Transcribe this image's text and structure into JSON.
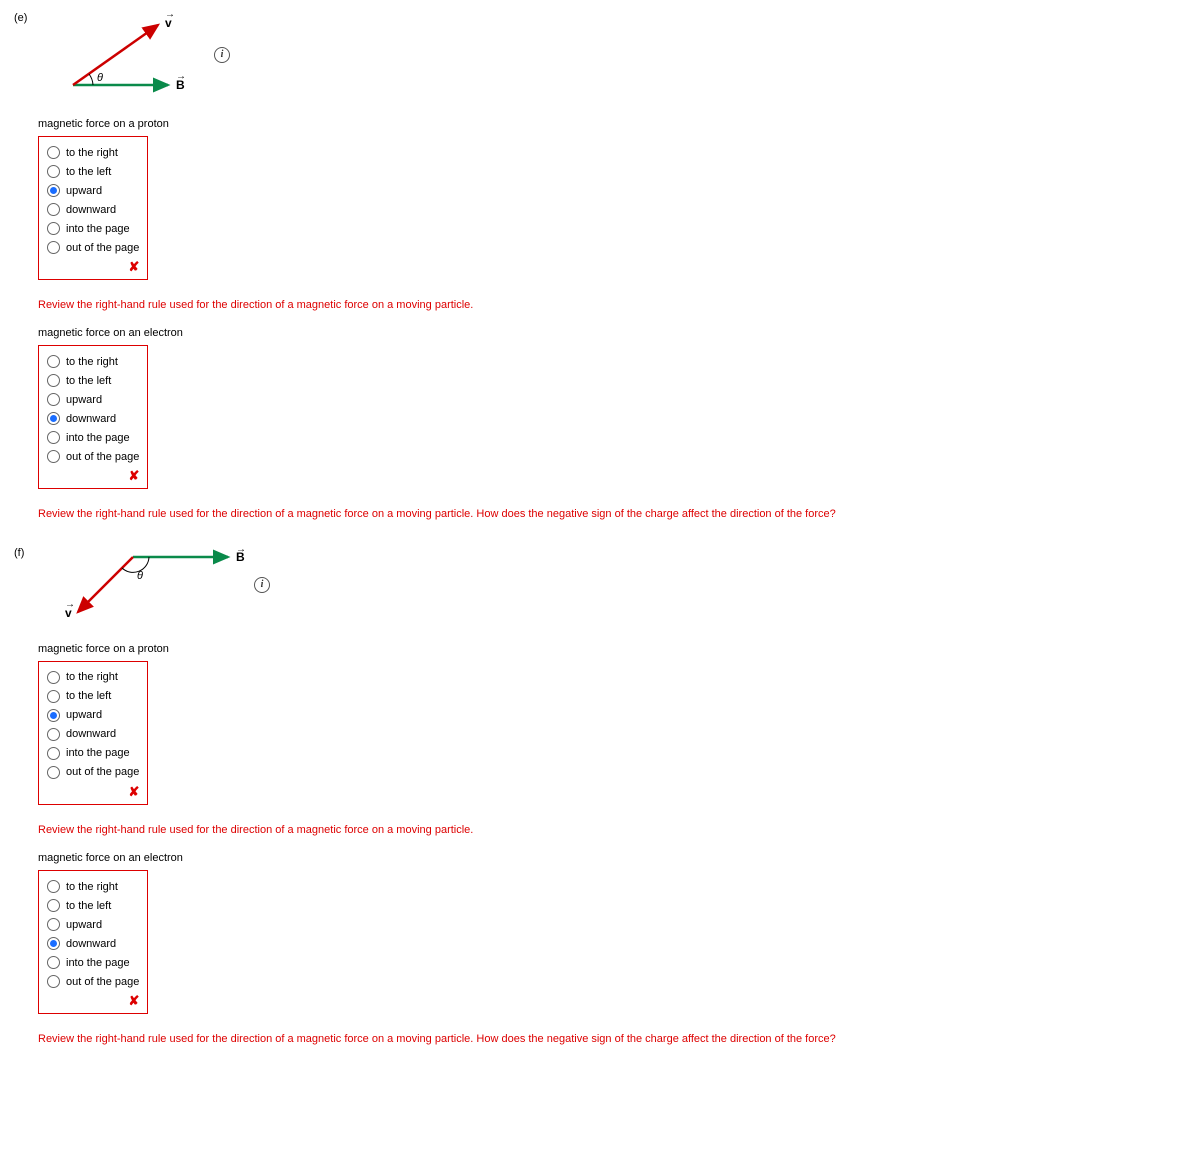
{
  "parts": [
    {
      "label": "(e)",
      "diagram": "e",
      "questions": [
        {
          "prompt": "magnetic force on a proton",
          "options": [
            "to the right",
            "to the left",
            "upward",
            "downward",
            "into the page",
            "out of the page"
          ],
          "selected": 2,
          "correct": false,
          "feedback": "Review the right-hand rule used for the direction of a magnetic force on a moving particle."
        },
        {
          "prompt": "magnetic force on an electron",
          "options": [
            "to the right",
            "to the left",
            "upward",
            "downward",
            "into the page",
            "out of the page"
          ],
          "selected": 3,
          "correct": false,
          "feedback": "Review the right-hand rule used for the direction of a magnetic force on a moving particle. How does the negative sign of the charge affect the direction of the force?"
        }
      ]
    },
    {
      "label": "(f)",
      "diagram": "f",
      "questions": [
        {
          "prompt": "magnetic force on a proton",
          "options": [
            "to the right",
            "to the left",
            "upward",
            "downward",
            "into the page",
            "out of the page"
          ],
          "selected": 2,
          "correct": false,
          "feedback": "Review the right-hand rule used for the direction of a magnetic force on a moving particle."
        },
        {
          "prompt": "magnetic force on an electron",
          "options": [
            "to the right",
            "to the left",
            "upward",
            "downward",
            "into the page",
            "out of the page"
          ],
          "selected": 3,
          "correct": false,
          "feedback": "Review the right-hand rule used for the direction of a magnetic force on a moving particle. How does the negative sign of the charge affect the direction of the force?"
        }
      ]
    }
  ],
  "vector_labels": {
    "v": "v",
    "B": "B",
    "theta": "θ"
  },
  "info_glyph": "i",
  "wrong_glyph": "✘"
}
